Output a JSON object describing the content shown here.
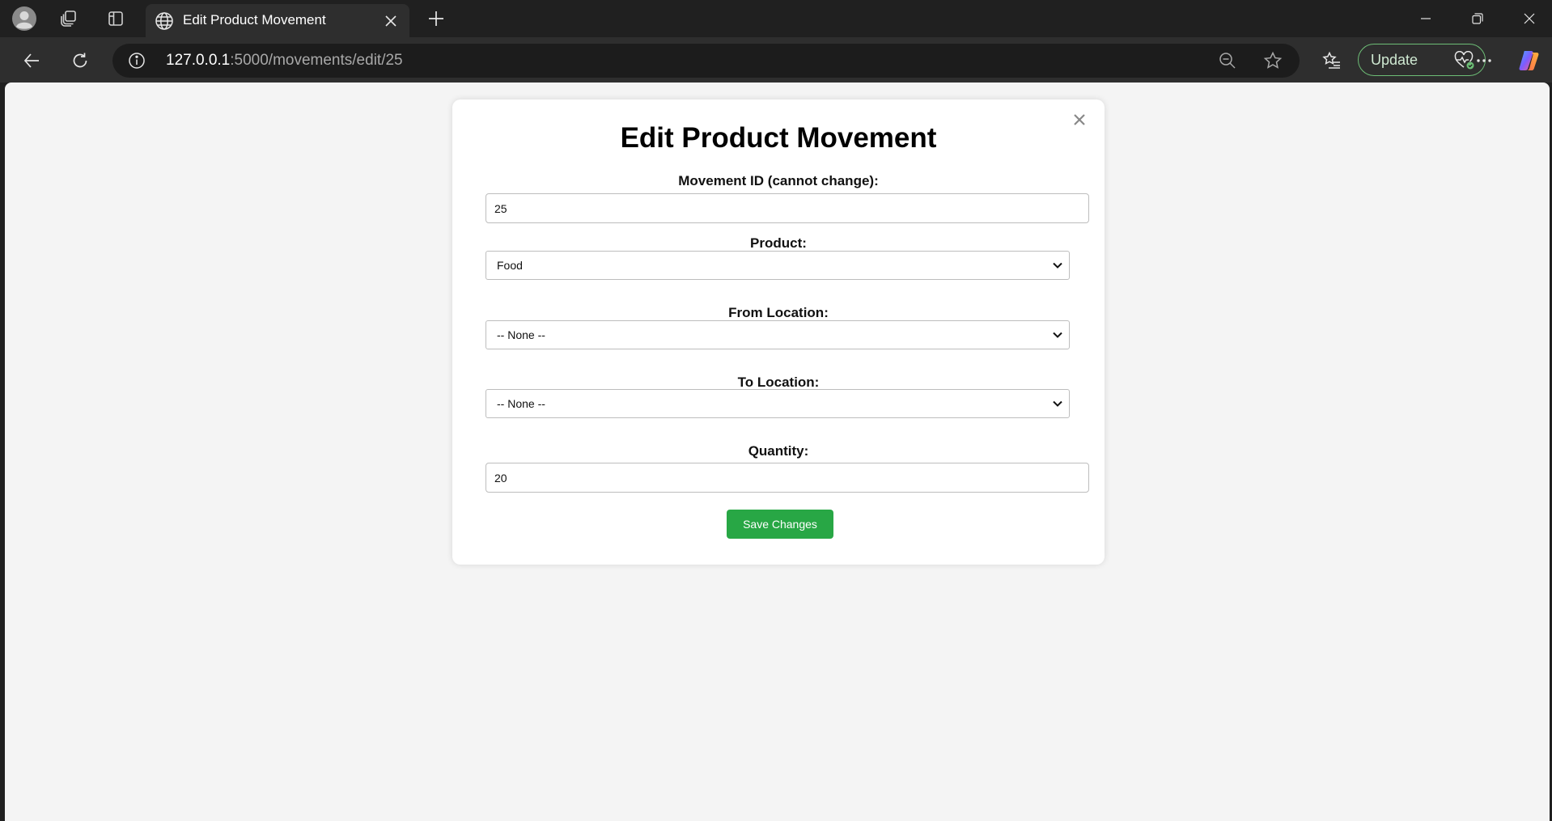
{
  "browser": {
    "tab": {
      "title": "Edit Product Movement"
    },
    "address": {
      "host": "127.0.0.1",
      "path": ":5000/movements/edit/25"
    },
    "update_label": "Update",
    "icons": {
      "profile": "profile-avatar-icon",
      "workspaces": "workspaces-icon",
      "tab_actions": "vertical-tabs-icon",
      "tab_favicon": "globe-icon",
      "new_tab": "plus-icon",
      "back": "arrow-left-icon",
      "refresh": "refresh-icon",
      "site_info": "info-icon",
      "zoom": "zoom-out-icon",
      "favorite": "star-icon",
      "favorites": "favorites-icon",
      "more": "more-icon",
      "copilot": "copilot-icon"
    },
    "accent_color": "#6dbd76"
  },
  "form": {
    "title": "Edit Product Movement",
    "movement_id": {
      "label": "Movement ID (cannot change):",
      "value": "25"
    },
    "product": {
      "label": "Product:",
      "selected": "Food"
    },
    "from_location": {
      "label": "From Location:",
      "selected": "-- None --"
    },
    "to_location": {
      "label": "To Location:",
      "selected": "-- None --"
    },
    "quantity": {
      "label": "Quantity:",
      "value": "20"
    },
    "save_label": "Save Changes",
    "save_color": "#28a745"
  }
}
